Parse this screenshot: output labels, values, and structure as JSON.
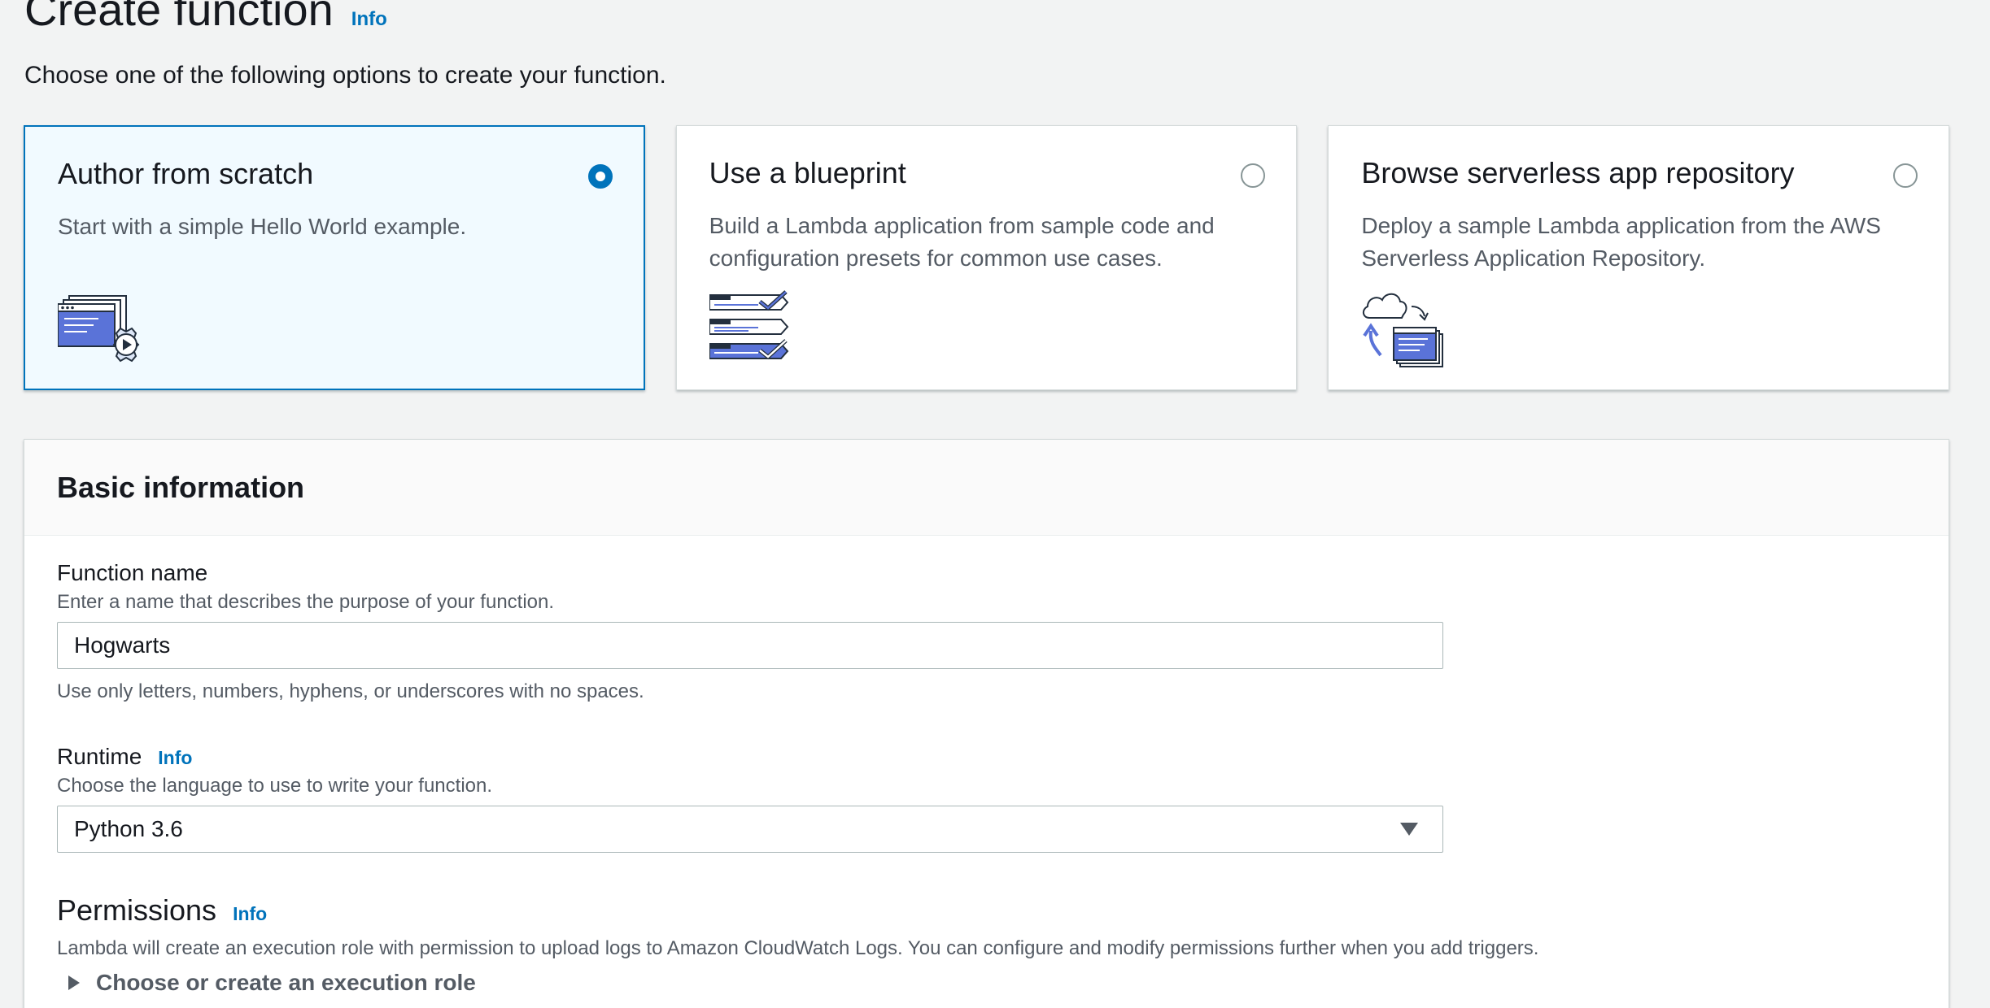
{
  "header": {
    "title": "Create function",
    "info_label": "Info",
    "subtitle": "Choose one of the following options to create your function."
  },
  "options": [
    {
      "title": "Author from scratch",
      "description": "Start with a simple Hello World example.",
      "selected": true,
      "icon": "author-from-scratch-icon"
    },
    {
      "title": "Use a blueprint",
      "description": "Build a Lambda application from sample code and configuration presets for common use cases.",
      "selected": false,
      "icon": "blueprint-icon"
    },
    {
      "title": "Browse serverless app repository",
      "description": "Deploy a sample Lambda application from the AWS Serverless Application Repository.",
      "selected": false,
      "icon": "serverless-repo-icon"
    }
  ],
  "basic_info": {
    "title": "Basic information",
    "function_name": {
      "label": "Function name",
      "description": "Enter a name that describes the purpose of your function.",
      "value": "Hogwarts",
      "constraint": "Use only letters, numbers, hyphens, or underscores with no spaces."
    },
    "runtime": {
      "label": "Runtime",
      "info_label": "Info",
      "description": "Choose the language to use to write your function.",
      "selected": "Python 3.6"
    },
    "permissions": {
      "title": "Permissions",
      "info_label": "Info",
      "description": "Lambda will create an execution role with permission to upload logs to Amazon CloudWatch Logs. You can configure and modify permissions further when you add triggers.",
      "expander_label": "Choose or create an execution role"
    }
  },
  "colors": {
    "accent": "#0073bb",
    "background": "#f2f3f3",
    "selected_tile_bg": "#f1faff",
    "text_secondary": "#545b64"
  }
}
